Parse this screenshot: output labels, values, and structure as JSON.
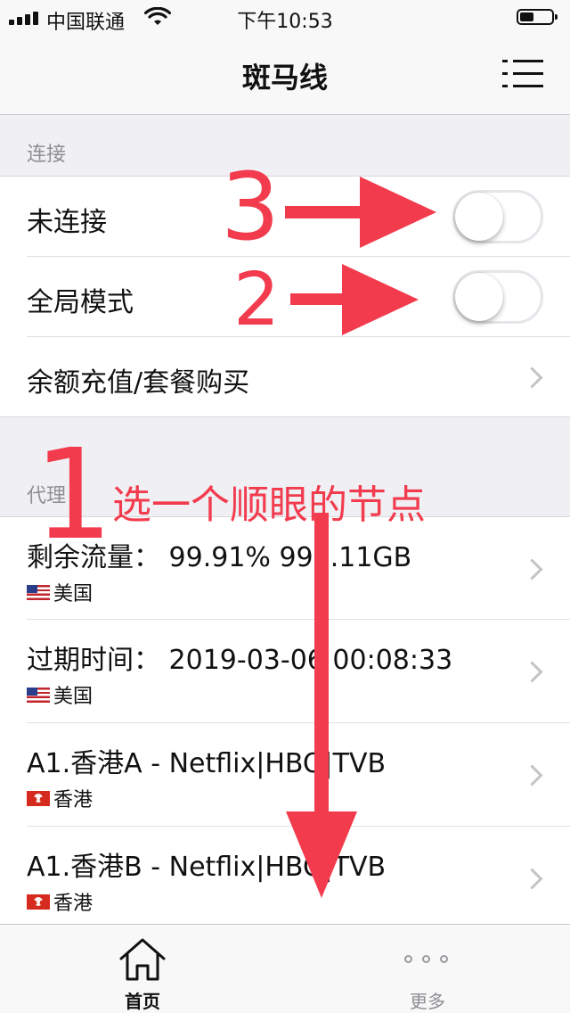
{
  "status_bar": {
    "carrier": "中国联通",
    "time": "下午10:53",
    "battery_level": 0.45
  },
  "nav": {
    "title": "斑马线",
    "menu_icon": "list-menu-icon"
  },
  "sections": {
    "connection_header": "连接",
    "proxy_header": "代理"
  },
  "connection_rows": {
    "connect": {
      "label": "未连接",
      "switch_on": false
    },
    "global_mode": {
      "label": "全局模式",
      "switch_on": false
    },
    "recharge": {
      "label": "余额充值/套餐购买"
    }
  },
  "proxy_rows": [
    {
      "title": "剩余流量：  99.91% 999.11GB",
      "region": "美国",
      "flag": "us-flag-icon"
    },
    {
      "title": "过期时间：  2019-03-06 00:08:33",
      "region": "美国",
      "flag": "us-flag-icon"
    },
    {
      "title": "A1.香港A - Netflix|HBO|TVB",
      "region": "香港",
      "flag": "hk-flag-icon"
    },
    {
      "title": "A1.香港B - Netflix|HBO|TVB",
      "region": "香港",
      "flag": "hk-flag-icon"
    }
  ],
  "tab_bar": {
    "home_label": "首页",
    "more_label": "更多",
    "home_icon": "house-icon",
    "more_icon": "more-dots-icon"
  },
  "annotations": {
    "num_3": "3",
    "num_2": "2",
    "num_1": "1",
    "hint": "选一个顺眼的节点",
    "color": "#f23b4d"
  }
}
